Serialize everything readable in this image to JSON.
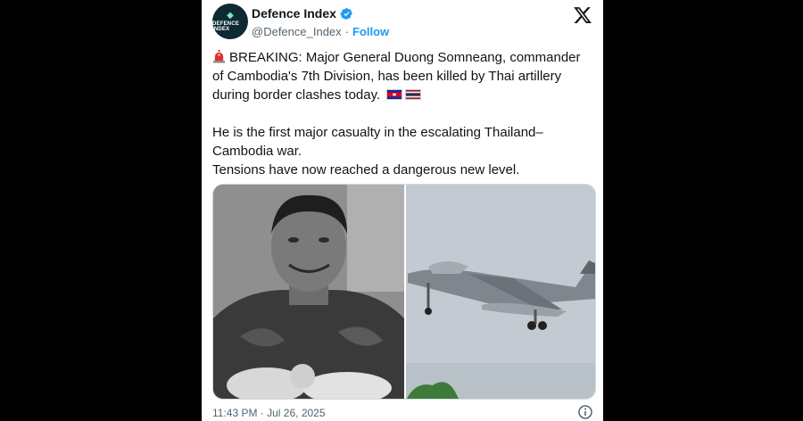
{
  "account": {
    "display_name": "Defence Index",
    "handle": "@Defence_Index",
    "separator": "·",
    "follow_label": "Follow",
    "avatar_mark": "◆",
    "avatar_text": "DEFENCE INDEX",
    "verified": true
  },
  "tweet": {
    "paragraph1": "BREAKING: Major General Duong Somneang, commander of Cambodia's 7th Division, has been killed by Thai artillery during border clashes today.",
    "line2": "He is the first major casualty in the escalating Thailand–Cambodia war.",
    "line3": "Tensions have now reached a dangerous new level.",
    "emoji": [
      "siren-icon",
      "cambodia-flag-icon",
      "thailand-flag-icon"
    ]
  },
  "media": {
    "items": [
      "portrait-photo",
      "fighter-jet-photo"
    ]
  },
  "footer": {
    "timestamp": "11:43 PM · Jul 26, 2025"
  },
  "colors": {
    "brand_blue": "#1d9bf0",
    "text": "#0f1419",
    "muted": "#536471"
  }
}
